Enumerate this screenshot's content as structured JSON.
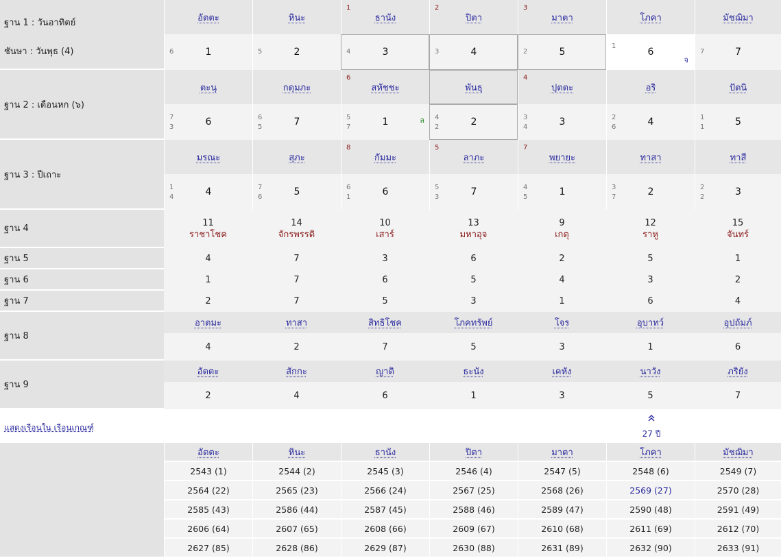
{
  "names_row1": [
    "อัตตะ",
    "หินะ",
    "ธานัง",
    "ปิตา",
    "มาตา",
    "โภคา",
    "มัชฌิมา"
  ],
  "corner_row1": [
    "",
    "",
    "1",
    "2",
    "3",
    "",
    ""
  ],
  "row1": {
    "label1": "ฐาน 1 : วันอาทิตย์",
    "label2": "ชันษา : วันพุธ (4)",
    "small": [
      "6",
      "5",
      "4",
      "3",
      "2",
      "1",
      "7"
    ],
    "big": [
      "1",
      "2",
      "3",
      "4",
      "5",
      "6",
      "7"
    ],
    "mark_chor": "จ"
  },
  "names_row2": [
    "ตะนุ",
    "กดุมภะ",
    "สหัชชะ",
    "พันธุ",
    "ปุตตะ",
    "อริ",
    "ปัตนิ"
  ],
  "corner_row2": [
    "",
    "",
    "6",
    "",
    "4",
    "",
    ""
  ],
  "row2": {
    "label": "ฐาน 2 : เดือนหก (๖)",
    "small_a": [
      "7",
      "6",
      "5",
      "4",
      "3",
      "2",
      "1"
    ],
    "small_b": [
      "3",
      "5",
      "7",
      "2",
      "4",
      "6",
      "1"
    ],
    "big": [
      "6",
      "7",
      "1",
      "2",
      "3",
      "4",
      "5"
    ],
    "mark_lor": "ล"
  },
  "names_row3": [
    "มรณะ",
    "สุภะ",
    "กัมมะ",
    "ลาภะ",
    "พยายะ",
    "ทาสา",
    "ทาสี"
  ],
  "corner_row3": [
    "",
    "",
    "8",
    "5",
    "7",
    "",
    ""
  ],
  "row3": {
    "label": "ฐาน 3 : ปีเถาะ",
    "small_a": [
      "1",
      "7",
      "6",
      "5",
      "4",
      "3",
      "2"
    ],
    "small_b": [
      "4",
      "6",
      "1",
      "3",
      "5",
      "7",
      "2"
    ],
    "big": [
      "4",
      "5",
      "6",
      "7",
      "1",
      "2",
      "3"
    ]
  },
  "row4": {
    "label": "ฐาน 4",
    "nums": [
      "11",
      "14",
      "10",
      "13",
      "9",
      "12",
      "15"
    ],
    "planets": [
      "ราชาโชค",
      "จักรพรรดิ",
      "เสาร์",
      "มหาอุจ",
      "เกตุ",
      "ราหู",
      "จันทร์"
    ]
  },
  "row5": {
    "label": "ฐาน 5",
    "vals": [
      "4",
      "7",
      "3",
      "6",
      "2",
      "5",
      "1"
    ]
  },
  "row6": {
    "label": "ฐาน 6",
    "vals": [
      "1",
      "7",
      "6",
      "5",
      "4",
      "3",
      "2"
    ]
  },
  "row7": {
    "label": "ฐาน 7",
    "vals": [
      "2",
      "7",
      "5",
      "3",
      "1",
      "6",
      "4"
    ]
  },
  "row8": {
    "label": "ฐาน 8",
    "names": [
      "อาตมะ",
      "ทาสา",
      "สิทธิโชค",
      "โภคทรัพย์",
      "โจร",
      "อุบาทว์",
      "อุปถัมภ์"
    ],
    "vals": [
      "4",
      "2",
      "7",
      "5",
      "3",
      "1",
      "6"
    ]
  },
  "row9": {
    "label": "ฐาน 9",
    "names": [
      "อัตตะ",
      "สักกะ",
      "ญาติ",
      "ธะนัง",
      "เคหัง",
      "นาวัง",
      "ภริยัง"
    ],
    "vals": [
      "2",
      "4",
      "6",
      "1",
      "3",
      "5",
      "7"
    ]
  },
  "link_text": "แสดงเรือนใน เรือนเกณฑ์",
  "arrow": "≈",
  "age": "27 ปี",
  "bottom": {
    "headers": [
      "อัตตะ",
      "หินะ",
      "ธานัง",
      "ปิตา",
      "มาตา",
      "โภคา",
      "มัชฌิมา"
    ],
    "rows": [
      [
        "2543 (1)",
        "2544 (2)",
        "2545 (3)",
        "2546 (4)",
        "2547 (5)",
        "2548 (6)",
        "2549 (7)"
      ],
      [
        "2564 (22)",
        "2565 (23)",
        "2566 (24)",
        "2567 (25)",
        "2568 (26)",
        "2569 (27)",
        "2570 (28)"
      ],
      [
        "2585 (43)",
        "2586 (44)",
        "2587 (45)",
        "2588 (46)",
        "2589 (47)",
        "2590 (48)",
        "2591 (49)"
      ],
      [
        "2606 (64)",
        "2607 (65)",
        "2608 (66)",
        "2609 (67)",
        "2610 (68)",
        "2611 (69)",
        "2612 (70)"
      ],
      [
        "2627 (85)",
        "2628 (86)",
        "2629 (87)",
        "2630 (88)",
        "2631 (89)",
        "2632 (90)",
        "2633 (91)"
      ]
    ]
  },
  "colors": {
    "link": "#2b2b9f",
    "accent_red": "#8b1a1a",
    "green": "#2a8a2a"
  }
}
